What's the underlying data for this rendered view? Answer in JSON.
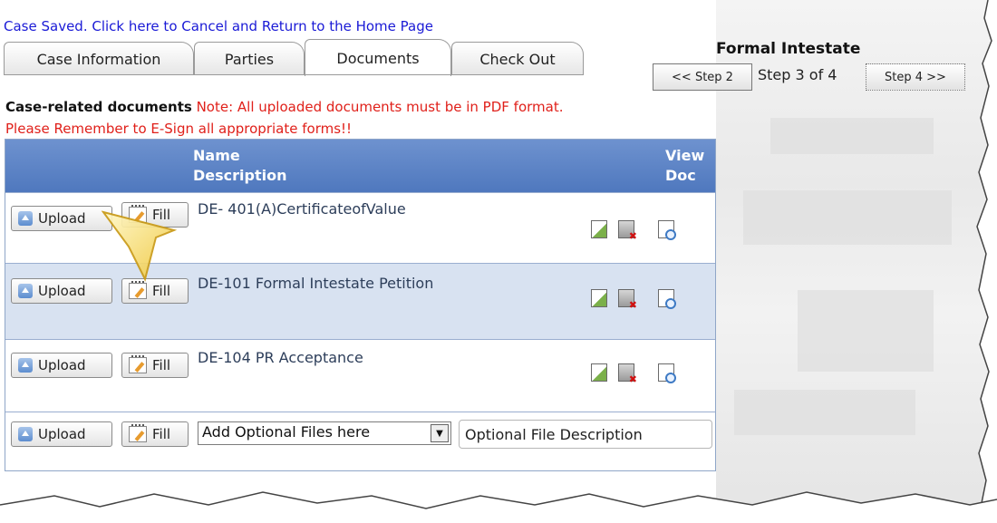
{
  "header": {
    "saved_link": "Case Saved. Click here to Cancel and Return to the Home Page",
    "title": "Formal Intestate",
    "prev_step": "<< Step 2",
    "step_status": "Step 3 of 4",
    "next_step": "Step 4 >>"
  },
  "tabs": [
    {
      "label": "Case Information",
      "active": false
    },
    {
      "label": "Parties",
      "active": false
    },
    {
      "label": "Documents",
      "active": true
    },
    {
      "label": "Check Out",
      "active": false
    }
  ],
  "documents": {
    "heading": "Case-related documents",
    "note": "Note: All uploaded documents must be in PDF format.",
    "esign_reminder": "Please Remember to E-Sign all appropriate forms!!",
    "columns": {
      "name": "Name",
      "description": "Description",
      "view1": "View",
      "view2": "Doc"
    },
    "upload_label": "Upload",
    "fill_label": "Fill",
    "rows": [
      {
        "name": "DE- 401(A)CertificateofValue"
      },
      {
        "name": "DE-101 Formal Intestate Petition"
      },
      {
        "name": "DE-104 PR Acceptance"
      }
    ],
    "optional": {
      "select_value": "Add Optional Files here",
      "description_value": "Optional File Description"
    }
  },
  "icons": {
    "upload": "upload-icon",
    "fill": "fill-form-icon",
    "edit": "edit-icon",
    "delete": "delete-icon",
    "view": "view-document-icon",
    "callout": "callout-arrow"
  },
  "colors": {
    "link": "#1a1ad6",
    "note": "#e0201a",
    "header_bg": "#5a80c4",
    "alt_row": "#d8e2f1"
  }
}
